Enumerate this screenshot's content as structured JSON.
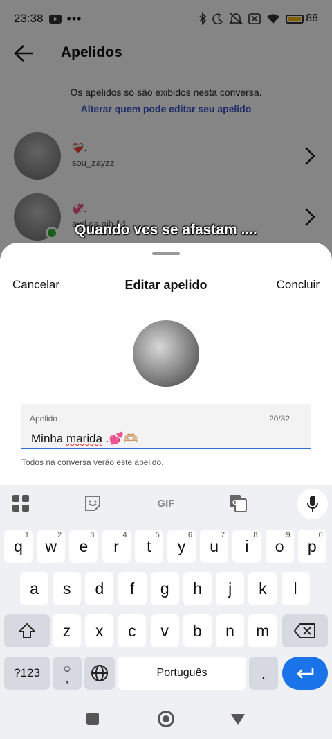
{
  "status": {
    "time": "23:38",
    "battery": "88"
  },
  "header": {
    "title": "Apelidos"
  },
  "info": {
    "text": "Os apelidos só são exibidos nesta conversa.",
    "link": "Alterar quem pode editar seu apelido"
  },
  "members": [
    {
      "nickname": "❤️‍🩹.",
      "username": "sou_zayzz"
    },
    {
      "nickname": "💞.",
      "username": "ayd da nih 14"
    }
  ],
  "caption": "Quando vcs se afastam ....",
  "sheet": {
    "cancel": "Cancelar",
    "title": "Editar apelido",
    "done": "Concluir",
    "field_label": "Apelido",
    "field_count": "20/32",
    "field_value_word1": "Minha",
    "field_value_word2": "marida",
    "field_value_rest": " .💕🫶🏼",
    "helper": "Todos na conversa verão este apelido."
  },
  "keyboard": {
    "toolbar_gif": "GIF",
    "row1": [
      {
        "k": "q",
        "n": "1"
      },
      {
        "k": "w",
        "n": "2"
      },
      {
        "k": "e",
        "n": "3"
      },
      {
        "k": "r",
        "n": "4"
      },
      {
        "k": "t",
        "n": "5"
      },
      {
        "k": "y",
        "n": "6"
      },
      {
        "k": "u",
        "n": "7"
      },
      {
        "k": "i",
        "n": "8"
      },
      {
        "k": "o",
        "n": "9"
      },
      {
        "k": "p",
        "n": "0"
      }
    ],
    "row2": [
      "a",
      "s",
      "d",
      "f",
      "g",
      "h",
      "j",
      "k",
      "l"
    ],
    "row3": [
      "z",
      "x",
      "c",
      "v",
      "b",
      "n",
      "m"
    ],
    "symbols": "?123",
    "comma": ",",
    "space": "Português",
    "period": "."
  }
}
